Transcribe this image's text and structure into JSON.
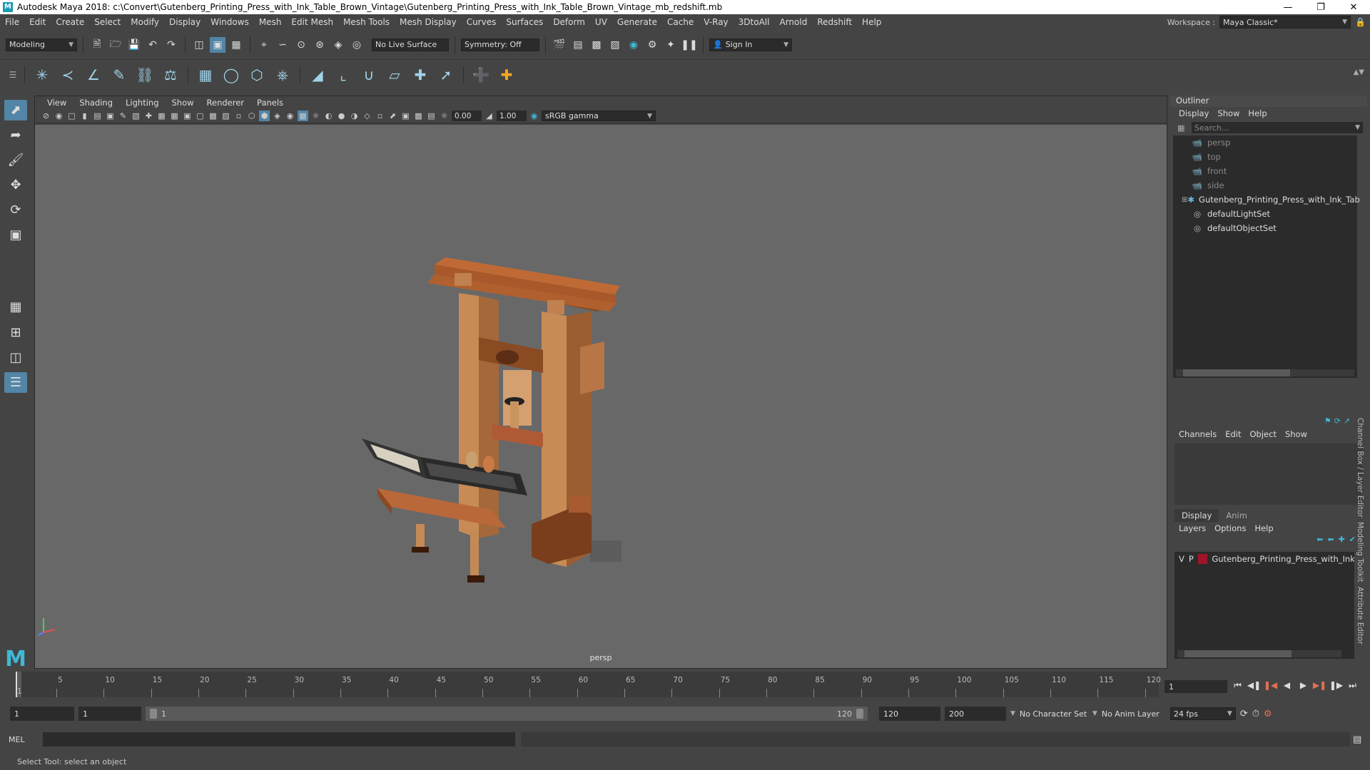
{
  "window": {
    "title": "Autodesk Maya 2018: c:\\Convert\\Gutenberg_Printing_Press_with_Ink_Table_Brown_Vintage\\Gutenberg_Printing_Press_with_Ink_Table_Brown_Vintage_mb_redshift.mb",
    "app_icon": "maya-logo-icon",
    "controls": [
      "minimize",
      "maximize",
      "close"
    ]
  },
  "menubar": {
    "items": [
      "File",
      "Edit",
      "Create",
      "Select",
      "Modify",
      "Display",
      "Windows",
      "Mesh",
      "Edit Mesh",
      "Mesh Tools",
      "Mesh Display",
      "Curves",
      "Surfaces",
      "Deform",
      "UV",
      "Generate",
      "Cache",
      "V-Ray",
      "3DtoAll",
      "Arnold",
      "Redshift",
      "Help"
    ],
    "workspace_label": "Workspace :",
    "workspace_value": "Maya Classic*"
  },
  "statusline": {
    "mode": "Modeling",
    "live_surface": "No Live Surface",
    "symmetry": "Symmetry: Off",
    "sign_in": "Sign In"
  },
  "viewport": {
    "menus": [
      "View",
      "Shading",
      "Lighting",
      "Show",
      "Renderer",
      "Panels"
    ],
    "exposure": "0.00",
    "gamma": "1.00",
    "color_space": "sRGB gamma",
    "camera": "persp"
  },
  "outliner": {
    "title": "Outliner",
    "menus": [
      "Display",
      "Show",
      "Help"
    ],
    "search_placeholder": "Search...",
    "items": [
      {
        "label": "persp",
        "icon": "camera-icon",
        "dim": true
      },
      {
        "label": "top",
        "icon": "camera-icon",
        "dim": true
      },
      {
        "label": "front",
        "icon": "camera-icon",
        "dim": true
      },
      {
        "label": "side",
        "icon": "camera-icon",
        "dim": true
      },
      {
        "label": "Gutenberg_Printing_Press_with_Ink_Tab",
        "icon": "transform-icon",
        "dim": false,
        "expandable": true
      },
      {
        "label": "defaultLightSet",
        "icon": "set-icon",
        "dim": false
      },
      {
        "label": "defaultObjectSet",
        "icon": "set-icon",
        "dim": false
      }
    ]
  },
  "channel_box": {
    "menus": [
      "Channels",
      "Edit",
      "Object",
      "Show"
    ]
  },
  "layer_editor": {
    "tabs": [
      "Display",
      "Anim"
    ],
    "menus": [
      "Layers",
      "Options",
      "Help"
    ],
    "layers": [
      {
        "v": "V",
        "p": "P",
        "color": "#a01428",
        "name": "Gutenberg_Printing_Press_with_Ink_"
      }
    ]
  },
  "side_tabs": [
    "Channel Box / Layer Editor",
    "Modeling Toolkit",
    "Attribute Editor"
  ],
  "timeline": {
    "ticks": [
      "5",
      "10",
      "15",
      "20",
      "25",
      "30",
      "35",
      "40",
      "45",
      "50",
      "55",
      "60",
      "65",
      "70",
      "75",
      "80",
      "85",
      "90",
      "95",
      "100",
      "105",
      "110",
      "115",
      "120"
    ],
    "start_label": "1",
    "current_frame": "1"
  },
  "range": {
    "start": "1",
    "playback_start": "1",
    "thumb_start": "1",
    "thumb_end": "120",
    "playback_end": "120",
    "end": "200",
    "character_set": "No Character Set",
    "anim_layer": "No Anim Layer",
    "fps": "24 fps"
  },
  "command": {
    "mode": "MEL"
  },
  "help_line": "Select Tool: select an object"
}
